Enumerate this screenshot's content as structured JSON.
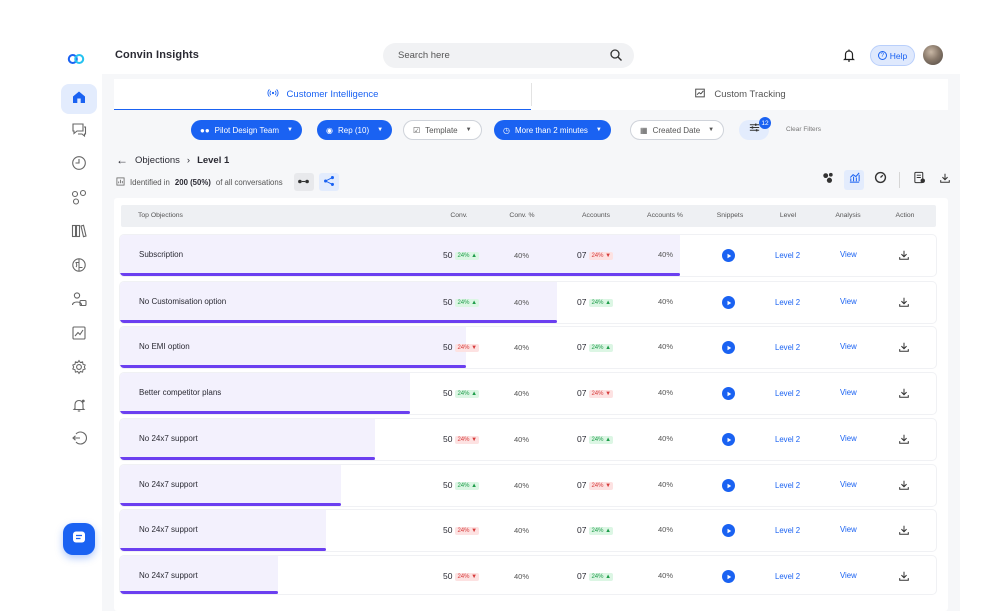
{
  "app": {
    "title": "Convin Insights",
    "search_placeholder": "Search here",
    "help_label": "Help",
    "accent": "#1a62f2",
    "bar_color": "#6b3ff0"
  },
  "sidebar": {
    "items": [
      {
        "icon": "home-icon"
      },
      {
        "icon": "chat-icon"
      },
      {
        "icon": "clock-icon"
      },
      {
        "icon": "nodes-icon"
      },
      {
        "icon": "library-icon"
      },
      {
        "icon": "brain-icon"
      },
      {
        "icon": "users-icon"
      },
      {
        "icon": "analytics-icon"
      },
      {
        "icon": "settings-icon"
      },
      {
        "icon": "notifications-icon"
      },
      {
        "icon": "logout-icon"
      }
    ]
  },
  "tabs": [
    {
      "label": "Customer Intelligence",
      "icon": "broadcast-icon",
      "active": true
    },
    {
      "label": "Custom Tracking",
      "icon": "tracking-icon",
      "active": false
    }
  ],
  "filters": {
    "team": "Pilot Design Team",
    "rep": "Rep (10)",
    "template": "Template",
    "duration": "More than 2 minutes",
    "date": "Created Date",
    "filter_count": "12",
    "clear": "Clear Filters"
  },
  "breadcrumb": {
    "parent": "Objections",
    "current": "Level 1"
  },
  "identified": {
    "prefix": "Identified in",
    "value": "200 (50%)",
    "suffix": "of all conversations"
  },
  "table": {
    "headers": {
      "name": "Top Objections",
      "conv": "Conv.",
      "conv_pct": "Conv. %",
      "accounts": "Accounts",
      "accounts_pct": "Accounts %",
      "snippets": "Snippets",
      "level": "Level",
      "analysis": "Analysis",
      "action": "Action"
    },
    "rows": [
      {
        "name": "Subscription",
        "conv": "50",
        "conv_change": "24%",
        "conv_dir": "up",
        "conv_pct": "40%",
        "accounts": "07",
        "acc_change": "24%",
        "acc_dir": "down",
        "accounts_pct": "40%",
        "level": "Level 2",
        "analysis": "View",
        "share": 0.686
      },
      {
        "name": "No Customisation option",
        "conv": "50",
        "conv_change": "24%",
        "conv_dir": "up",
        "conv_pct": "40%",
        "accounts": "07",
        "acc_change": "24%",
        "acc_dir": "up",
        "accounts_pct": "40%",
        "level": "Level 2",
        "analysis": "View",
        "share": 0.536
      },
      {
        "name": "No EMI option",
        "conv": "50",
        "conv_change": "24%",
        "conv_dir": "down",
        "conv_pct": "40%",
        "accounts": "07",
        "acc_change": "24%",
        "acc_dir": "up",
        "accounts_pct": "40%",
        "level": "Level 2",
        "analysis": "View",
        "share": 0.424
      },
      {
        "name": "Better competitor plans",
        "conv": "50",
        "conv_change": "24%",
        "conv_dir": "up",
        "conv_pct": "40%",
        "accounts": "07",
        "acc_change": "24%",
        "acc_dir": "down",
        "accounts_pct": "40%",
        "level": "Level 2",
        "analysis": "View",
        "share": 0.356
      },
      {
        "name": "No 24x7 support",
        "conv": "50",
        "conv_change": "24%",
        "conv_dir": "down",
        "conv_pct": "40%",
        "accounts": "07",
        "acc_change": "24%",
        "acc_dir": "up",
        "accounts_pct": "40%",
        "level": "Level 2",
        "analysis": "View",
        "share": 0.313
      },
      {
        "name": "No 24x7 support",
        "conv": "50",
        "conv_change": "24%",
        "conv_dir": "up",
        "conv_pct": "40%",
        "accounts": "07",
        "acc_change": "24%",
        "acc_dir": "down",
        "accounts_pct": "40%",
        "level": "Level 2",
        "analysis": "View",
        "share": 0.271
      },
      {
        "name": "No 24x7 support",
        "conv": "50",
        "conv_change": "24%",
        "conv_dir": "down",
        "conv_pct": "40%",
        "accounts": "07",
        "acc_change": "24%",
        "acc_dir": "up",
        "accounts_pct": "40%",
        "level": "Level 2",
        "analysis": "View",
        "share": 0.253
      },
      {
        "name": "No 24x7 support",
        "conv": "50",
        "conv_change": "24%",
        "conv_dir": "down",
        "conv_pct": "40%",
        "accounts": "07",
        "acc_change": "24%",
        "acc_dir": "up",
        "accounts_pct": "40%",
        "level": "Level 2",
        "analysis": "View",
        "share": 0.194
      }
    ]
  }
}
